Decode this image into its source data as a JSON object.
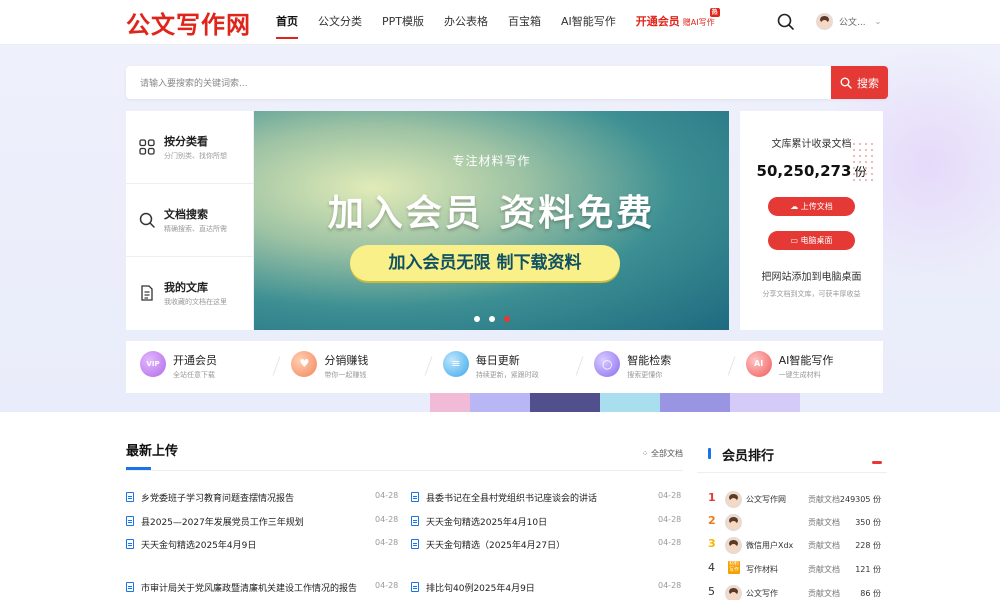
{
  "header": {
    "logo": "公文写作网",
    "nav": [
      {
        "label": "首页",
        "active": true
      },
      {
        "label": "公文分类"
      },
      {
        "label": "PPT模版"
      },
      {
        "label": "办公表格"
      },
      {
        "label": "百宝箱"
      },
      {
        "label": "AI智能写作"
      }
    ],
    "vip": {
      "label": "开通会员",
      "extra": "赠AI写作",
      "hot": "热"
    },
    "user_name": "公文..."
  },
  "search": {
    "placeholder": "请输入要搜索的关键词索...",
    "button": "搜索"
  },
  "left_menu": [
    {
      "title": "按分类看",
      "sub": "分门别类、找你所想",
      "icon": "grid-icon"
    },
    {
      "title": "文档搜索",
      "sub": "精确搜索、直达所需",
      "icon": "search-icon"
    },
    {
      "title": "我的文库",
      "sub": "我收藏的文档在这里",
      "icon": "document-icon"
    }
  ],
  "banner": {
    "subtitle": "专注材料写作",
    "title": "加入会员 资料免费",
    "pill": "加入会员无限 制下载资料",
    "active_slide": 3
  },
  "stats": {
    "label": "文库累计收录文档",
    "count": "50,250,273",
    "unit": "份",
    "upload_btn": "上传文档",
    "desktop_btn": "电脑桌面",
    "add_title": "把网站添加到电脑桌面",
    "add_tip": "分享文档到文库，可获丰厚收益"
  },
  "features": [
    {
      "title": "开通会员",
      "sub": "全站任意下载",
      "color": "#b26ae6",
      "icon": "vip-icon"
    },
    {
      "title": "分销赚钱",
      "sub": "带你一起赚钱",
      "color": "#f2855a",
      "icon": "gift-icon"
    },
    {
      "title": "每日更新",
      "sub": "持续更新，紧跟时政",
      "color": "#3aa7e8",
      "icon": "calendar-icon"
    },
    {
      "title": "智能检索",
      "sub": "搜索更懂你",
      "color": "#8a6bf0",
      "icon": "smart-search-icon"
    },
    {
      "title": "AI智能写作",
      "sub": "一键生成材料",
      "color": "#f05a5a",
      "icon": "ai-icon"
    }
  ],
  "latest": {
    "title": "最新上传",
    "all": "全部文档",
    "left": [
      {
        "title": "乡党委班子学习教育问题查摆情况报告",
        "date": "04-28"
      },
      {
        "title": "县2025—2027年发展党员工作三年规划",
        "date": "04-28"
      },
      {
        "title": "天天金句精选2025年4月9日",
        "date": "04-28"
      },
      {
        "title": "市审计局关于党风廉政暨清廉机关建设工作情况的报告",
        "date": "04-28"
      }
    ],
    "right": [
      {
        "title": "县委书记在全县村党组织书记座谈会的讲话",
        "date": "04-28"
      },
      {
        "title": "天天金句精选2025年4月10日",
        "date": "04-28"
      },
      {
        "title": "天天金句精选（2025年4月27日）",
        "date": "04-28"
      },
      {
        "title": "排比句40例2025年4月9日",
        "date": "04-28"
      }
    ]
  },
  "ranking": {
    "title": "会员排行",
    "rows": [
      {
        "no": "1",
        "name": "公文写作网",
        "label": "贡献文档",
        "score": "249305 份",
        "color": "#e53935"
      },
      {
        "no": "2",
        "name": "",
        "label": "贡献文档",
        "score": "350 份",
        "color": "#f07a1a"
      },
      {
        "no": "3",
        "name": "微信用户Xdx",
        "label": "贡献文档",
        "score": "228 份",
        "color": "#f5b800"
      },
      {
        "no": "4",
        "name": "写作材料",
        "label": "贡献文档",
        "score": "121 份",
        "color": "#333333",
        "badge": "材料写作"
      },
      {
        "no": "5",
        "name": "公文写作",
        "label": "贡献文档",
        "score": "86 份",
        "color": "#333333"
      }
    ]
  }
}
